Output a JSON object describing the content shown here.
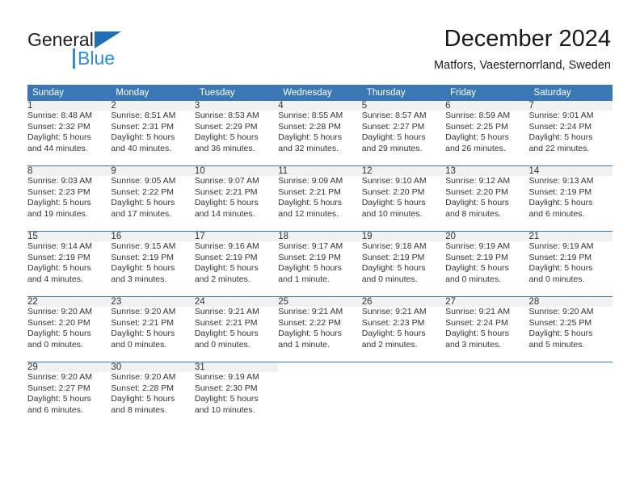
{
  "brand": {
    "name_part1": "General",
    "name_part2": "Blue",
    "triangle_icon": "triangle-logo-icon",
    "color_dark": "#231f20",
    "color_blue": "#2e8fd6"
  },
  "header": {
    "title": "December 2024",
    "subtitle": "Matfors, Vaesternorrland, Sweden"
  },
  "colors": {
    "header_blue": "#3a78b5",
    "daynum_gray": "#f1f1f1",
    "text": "#333333"
  },
  "calendar": {
    "weekday_headers": [
      "Sunday",
      "Monday",
      "Tuesday",
      "Wednesday",
      "Thursday",
      "Friday",
      "Saturday"
    ],
    "weeks": [
      [
        {
          "day": "1",
          "sunrise": "Sunrise: 8:48 AM",
          "sunset": "Sunset: 2:32 PM",
          "daylight1": "Daylight: 5 hours",
          "daylight2": "and 44 minutes."
        },
        {
          "day": "2",
          "sunrise": "Sunrise: 8:51 AM",
          "sunset": "Sunset: 2:31 PM",
          "daylight1": "Daylight: 5 hours",
          "daylight2": "and 40 minutes."
        },
        {
          "day": "3",
          "sunrise": "Sunrise: 8:53 AM",
          "sunset": "Sunset: 2:29 PM",
          "daylight1": "Daylight: 5 hours",
          "daylight2": "and 36 minutes."
        },
        {
          "day": "4",
          "sunrise": "Sunrise: 8:55 AM",
          "sunset": "Sunset: 2:28 PM",
          "daylight1": "Daylight: 5 hours",
          "daylight2": "and 32 minutes."
        },
        {
          "day": "5",
          "sunrise": "Sunrise: 8:57 AM",
          "sunset": "Sunset: 2:27 PM",
          "daylight1": "Daylight: 5 hours",
          "daylight2": "and 29 minutes."
        },
        {
          "day": "6",
          "sunrise": "Sunrise: 8:59 AM",
          "sunset": "Sunset: 2:25 PM",
          "daylight1": "Daylight: 5 hours",
          "daylight2": "and 26 minutes."
        },
        {
          "day": "7",
          "sunrise": "Sunrise: 9:01 AM",
          "sunset": "Sunset: 2:24 PM",
          "daylight1": "Daylight: 5 hours",
          "daylight2": "and 22 minutes."
        }
      ],
      [
        {
          "day": "8",
          "sunrise": "Sunrise: 9:03 AM",
          "sunset": "Sunset: 2:23 PM",
          "daylight1": "Daylight: 5 hours",
          "daylight2": "and 19 minutes."
        },
        {
          "day": "9",
          "sunrise": "Sunrise: 9:05 AM",
          "sunset": "Sunset: 2:22 PM",
          "daylight1": "Daylight: 5 hours",
          "daylight2": "and 17 minutes."
        },
        {
          "day": "10",
          "sunrise": "Sunrise: 9:07 AM",
          "sunset": "Sunset: 2:21 PM",
          "daylight1": "Daylight: 5 hours",
          "daylight2": "and 14 minutes."
        },
        {
          "day": "11",
          "sunrise": "Sunrise: 9:09 AM",
          "sunset": "Sunset: 2:21 PM",
          "daylight1": "Daylight: 5 hours",
          "daylight2": "and 12 minutes."
        },
        {
          "day": "12",
          "sunrise": "Sunrise: 9:10 AM",
          "sunset": "Sunset: 2:20 PM",
          "daylight1": "Daylight: 5 hours",
          "daylight2": "and 10 minutes."
        },
        {
          "day": "13",
          "sunrise": "Sunrise: 9:12 AM",
          "sunset": "Sunset: 2:20 PM",
          "daylight1": "Daylight: 5 hours",
          "daylight2": "and 8 minutes."
        },
        {
          "day": "14",
          "sunrise": "Sunrise: 9:13 AM",
          "sunset": "Sunset: 2:19 PM",
          "daylight1": "Daylight: 5 hours",
          "daylight2": "and 6 minutes."
        }
      ],
      [
        {
          "day": "15",
          "sunrise": "Sunrise: 9:14 AM",
          "sunset": "Sunset: 2:19 PM",
          "daylight1": "Daylight: 5 hours",
          "daylight2": "and 4 minutes."
        },
        {
          "day": "16",
          "sunrise": "Sunrise: 9:15 AM",
          "sunset": "Sunset: 2:19 PM",
          "daylight1": "Daylight: 5 hours",
          "daylight2": "and 3 minutes."
        },
        {
          "day": "17",
          "sunrise": "Sunrise: 9:16 AM",
          "sunset": "Sunset: 2:19 PM",
          "daylight1": "Daylight: 5 hours",
          "daylight2": "and 2 minutes."
        },
        {
          "day": "18",
          "sunrise": "Sunrise: 9:17 AM",
          "sunset": "Sunset: 2:19 PM",
          "daylight1": "Daylight: 5 hours",
          "daylight2": "and 1 minute."
        },
        {
          "day": "19",
          "sunrise": "Sunrise: 9:18 AM",
          "sunset": "Sunset: 2:19 PM",
          "daylight1": "Daylight: 5 hours",
          "daylight2": "and 0 minutes."
        },
        {
          "day": "20",
          "sunrise": "Sunrise: 9:19 AM",
          "sunset": "Sunset: 2:19 PM",
          "daylight1": "Daylight: 5 hours",
          "daylight2": "and 0 minutes."
        },
        {
          "day": "21",
          "sunrise": "Sunrise: 9:19 AM",
          "sunset": "Sunset: 2:19 PM",
          "daylight1": "Daylight: 5 hours",
          "daylight2": "and 0 minutes."
        }
      ],
      [
        {
          "day": "22",
          "sunrise": "Sunrise: 9:20 AM",
          "sunset": "Sunset: 2:20 PM",
          "daylight1": "Daylight: 5 hours",
          "daylight2": "and 0 minutes."
        },
        {
          "day": "23",
          "sunrise": "Sunrise: 9:20 AM",
          "sunset": "Sunset: 2:21 PM",
          "daylight1": "Daylight: 5 hours",
          "daylight2": "and 0 minutes."
        },
        {
          "day": "24",
          "sunrise": "Sunrise: 9:21 AM",
          "sunset": "Sunset: 2:21 PM",
          "daylight1": "Daylight: 5 hours",
          "daylight2": "and 0 minutes."
        },
        {
          "day": "25",
          "sunrise": "Sunrise: 9:21 AM",
          "sunset": "Sunset: 2:22 PM",
          "daylight1": "Daylight: 5 hours",
          "daylight2": "and 1 minute."
        },
        {
          "day": "26",
          "sunrise": "Sunrise: 9:21 AM",
          "sunset": "Sunset: 2:23 PM",
          "daylight1": "Daylight: 5 hours",
          "daylight2": "and 2 minutes."
        },
        {
          "day": "27",
          "sunrise": "Sunrise: 9:21 AM",
          "sunset": "Sunset: 2:24 PM",
          "daylight1": "Daylight: 5 hours",
          "daylight2": "and 3 minutes."
        },
        {
          "day": "28",
          "sunrise": "Sunrise: 9:20 AM",
          "sunset": "Sunset: 2:25 PM",
          "daylight1": "Daylight: 5 hours",
          "daylight2": "and 5 minutes."
        }
      ],
      [
        {
          "day": "29",
          "sunrise": "Sunrise: 9:20 AM",
          "sunset": "Sunset: 2:27 PM",
          "daylight1": "Daylight: 5 hours",
          "daylight2": "and 6 minutes."
        },
        {
          "day": "30",
          "sunrise": "Sunrise: 9:20 AM",
          "sunset": "Sunset: 2:28 PM",
          "daylight1": "Daylight: 5 hours",
          "daylight2": "and 8 minutes."
        },
        {
          "day": "31",
          "sunrise": "Sunrise: 9:19 AM",
          "sunset": "Sunset: 2:30 PM",
          "daylight1": "Daylight: 5 hours",
          "daylight2": "and 10 minutes."
        },
        {
          "day": "",
          "sunrise": "",
          "sunset": "",
          "daylight1": "",
          "daylight2": ""
        },
        {
          "day": "",
          "sunrise": "",
          "sunset": "",
          "daylight1": "",
          "daylight2": ""
        },
        {
          "day": "",
          "sunrise": "",
          "sunset": "",
          "daylight1": "",
          "daylight2": ""
        },
        {
          "day": "",
          "sunrise": "",
          "sunset": "",
          "daylight1": "",
          "daylight2": ""
        }
      ]
    ]
  }
}
